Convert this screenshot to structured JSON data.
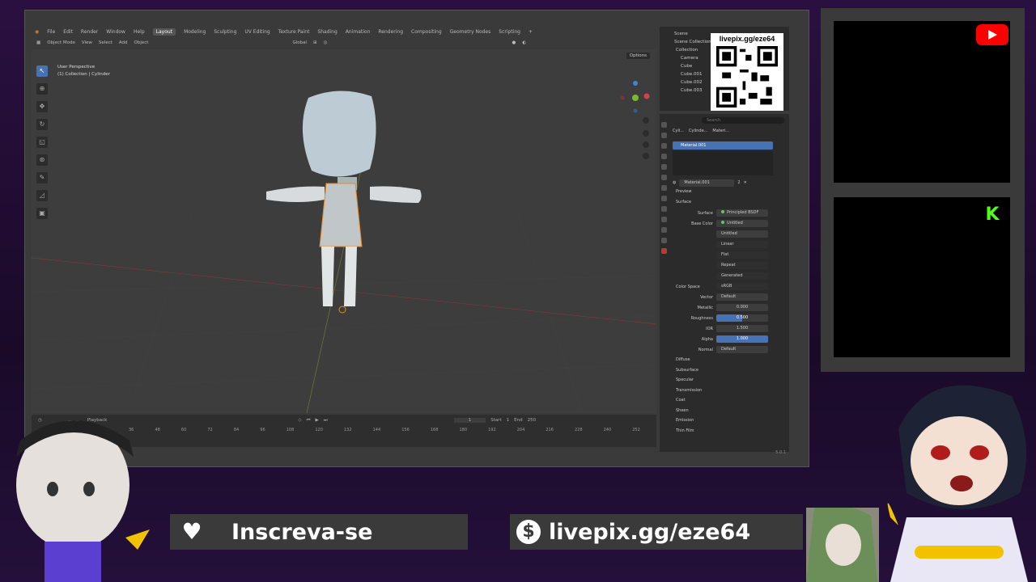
{
  "topbar": {
    "menus": [
      "File",
      "Edit",
      "Render",
      "Window",
      "Help"
    ],
    "workspaces": [
      "Layout",
      "Modeling",
      "Sculpting",
      "UV Editing",
      "Texture Paint",
      "Shading",
      "Animation",
      "Rendering",
      "Compositing",
      "Geometry Nodes",
      "Scripting"
    ],
    "active_workspace": "Layout",
    "add_tab": "+"
  },
  "viewport_header": {
    "mode": "Object Mode",
    "menus": [
      "View",
      "Select",
      "Add",
      "Object"
    ],
    "transform": "Global",
    "options": "Options"
  },
  "viewport": {
    "perspective": "User Perspective",
    "collection_path": "(1) Collection | Cylinder"
  },
  "timeline": {
    "playback": "Playback",
    "current_frame": "1",
    "start_label": "Start",
    "start": "1",
    "end_label": "End",
    "end": "250",
    "ruler": [
      "36",
      "48",
      "60",
      "72",
      "84",
      "96",
      "108",
      "120",
      "132",
      "144",
      "156",
      "168",
      "180",
      "192",
      "204",
      "216",
      "228",
      "240",
      "252"
    ]
  },
  "outliner": {
    "scene": "Scene",
    "scene_collection": "Scene Collection",
    "collection": "Collection",
    "items": [
      "Camera",
      "Cube",
      "Cube.001",
      "Cube.002",
      "Cube.003"
    ]
  },
  "properties": {
    "search_placeholder": "Search",
    "breadcrumb": [
      "Cyli...",
      "Cylinde...",
      "Materi..."
    ],
    "material_slot": "Material.001",
    "material_name": "Material.001",
    "users": "2",
    "preview": "Preview",
    "surface_section": "Surface",
    "rows": {
      "surface": {
        "label": "Surface",
        "value": "Principled BSDF"
      },
      "base_color": {
        "label": "Base Color",
        "value": "Untitled"
      },
      "image": {
        "value": "Untitled"
      },
      "interp": "Linear",
      "proj": "Flat",
      "ext": "Repeat",
      "source": "Generated",
      "color_space": {
        "label": "Color Space",
        "value": "sRGB"
      },
      "vector": {
        "label": "Vector",
        "value": "Default"
      },
      "metallic": {
        "label": "Metallic",
        "value": "0.000"
      },
      "roughness": {
        "label": "Roughness",
        "value": "0.500",
        "fill": 0.5
      },
      "ior": {
        "label": "IOR",
        "value": "1.500"
      },
      "alpha": {
        "label": "Alpha",
        "value": "1.000",
        "fill": 1.0
      },
      "normal": {
        "label": "Normal",
        "value": "Default"
      }
    },
    "subsections": [
      "Diffuse",
      "Subsurface",
      "Specular",
      "Transmission",
      "Coat",
      "Sheen",
      "Emission",
      "Thin Film"
    ],
    "version": "5.0.1"
  },
  "overlay": {
    "qr_label": "livepix.gg/eze64",
    "subscribe": "Inscreva-se",
    "donate_url": "livepix.gg/eze64",
    "colors": {
      "youtube": "#ff0000",
      "kick": "#53fc18",
      "accent": "#4772b3"
    }
  }
}
